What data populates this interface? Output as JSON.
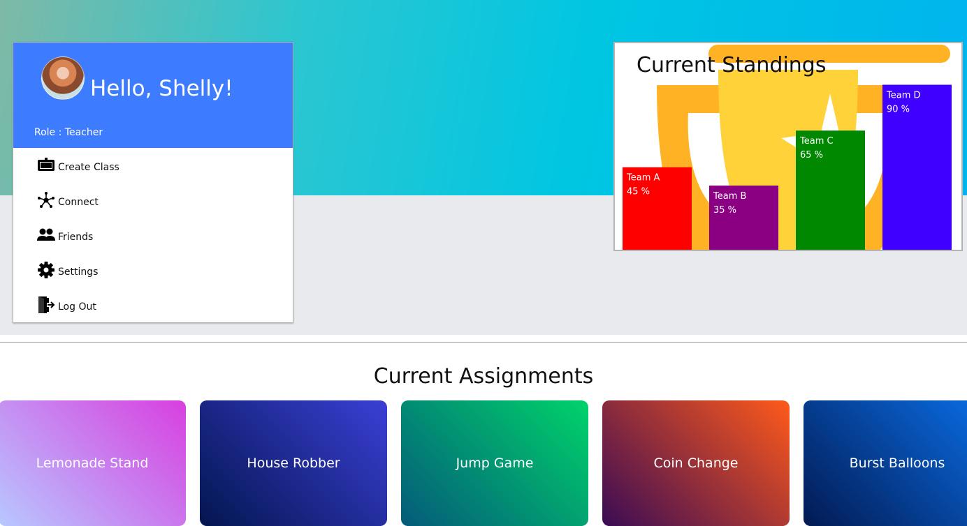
{
  "profile": {
    "greeting": "Hello, Shelly!",
    "role_label": "Role : Teacher",
    "header_color": "#3d7bff"
  },
  "menu": {
    "items": [
      {
        "label": "Create Class",
        "icon": "tv-icon"
      },
      {
        "label": "Connect",
        "icon": "network-icon"
      },
      {
        "label": "Friends",
        "icon": "people-icon"
      },
      {
        "label": "Settings",
        "icon": "gear-icon"
      },
      {
        "label": "Log Out",
        "icon": "logout-icon"
      }
    ]
  },
  "standings": {
    "title": "Current Standings",
    "chart_data": {
      "type": "bar",
      "categories": [
        "Team A",
        "Team B",
        "Team C",
        "Team D"
      ],
      "values": [
        45,
        35,
        65,
        90
      ],
      "unit": "%",
      "ylim": [
        0,
        100
      ],
      "colors": [
        "#ff0000",
        "#8b0082",
        "#008800",
        "#4000ff"
      ]
    }
  },
  "assignments": {
    "title": "Current Assignments",
    "cards": [
      {
        "label": "Lemonade Stand",
        "gradient": [
          "#b8c8ff",
          "#d83fe0"
        ]
      },
      {
        "label": "House Robber",
        "gradient": [
          "#03164f",
          "#3b3fd6"
        ]
      },
      {
        "label": "Jump Game",
        "gradient": [
          "#045a7a",
          "#00d36a"
        ]
      },
      {
        "label": "Coin Change",
        "gradient": [
          "#3a0b55",
          "#ff5a1a"
        ]
      },
      {
        "label": "Burst Balloons",
        "gradient": [
          "#021a52",
          "#0a6ee6"
        ]
      }
    ]
  }
}
